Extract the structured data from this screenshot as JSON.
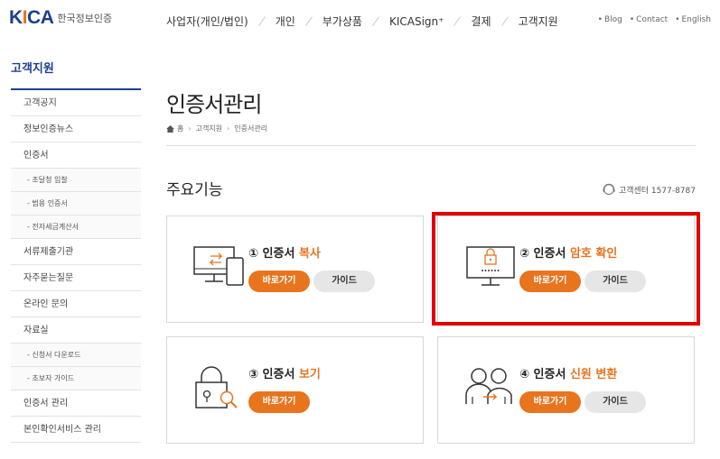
{
  "header": {
    "logo_mark": "KICA",
    "logo_text": "한국정보인증",
    "nav": [
      "사업자(개인/법인)",
      "개인",
      "부가상품",
      "KICASign⁺",
      "결제",
      "고객지원"
    ],
    "util": [
      "Blog",
      "Contact",
      "English"
    ]
  },
  "sidebar": {
    "title": "고객지원",
    "items": [
      {
        "label": "고객공지",
        "sub": false
      },
      {
        "label": "정보인증뉴스",
        "sub": false
      },
      {
        "label": "인증서",
        "sub": false
      },
      {
        "label": "- 조달청 입찰",
        "sub": true
      },
      {
        "label": "- 범용 인증서",
        "sub": true
      },
      {
        "label": "- 전자세금계산서",
        "sub": true
      },
      {
        "label": "서류제출기관",
        "sub": false
      },
      {
        "label": "자주묻는질문",
        "sub": false
      },
      {
        "label": "온라인 문의",
        "sub": false
      },
      {
        "label": "자료실",
        "sub": false
      },
      {
        "label": "- 신청서 다운로드",
        "sub": true
      },
      {
        "label": "- 초보자 가이드",
        "sub": true
      },
      {
        "label": "인증서 관리",
        "sub": false
      },
      {
        "label": "본인확인서비스 관리",
        "sub": false
      }
    ]
  },
  "main": {
    "page_title": "인증서관리",
    "breadcrumb": [
      "홈",
      "고객지원",
      "인증서관리"
    ],
    "section_title": "주요기능",
    "customer_center": "고객센터 1577-8787",
    "cards": [
      {
        "num": "①",
        "prefix": "인증서 ",
        "accent": "복사",
        "icon": "monitor-transfer-icon",
        "go": "바로가기",
        "guide": "가이드"
      },
      {
        "num": "②",
        "prefix": "인증서 ",
        "accent": "암호 확인",
        "icon": "monitor-lock-icon",
        "go": "바로가기",
        "guide": "가이드"
      },
      {
        "num": "③",
        "prefix": "인증서 ",
        "accent": "보기",
        "icon": "lock-search-icon",
        "go": "바로가기",
        "guide": ""
      },
      {
        "num": "④",
        "prefix": "인증서 ",
        "accent": "신원 변환",
        "icon": "people-exchange-icon",
        "go": "바로가기",
        "guide": "가이드"
      }
    ]
  },
  "colors": {
    "brand": "#1b3f8f",
    "accent": "#e8741e",
    "highlight": "#e00000"
  }
}
